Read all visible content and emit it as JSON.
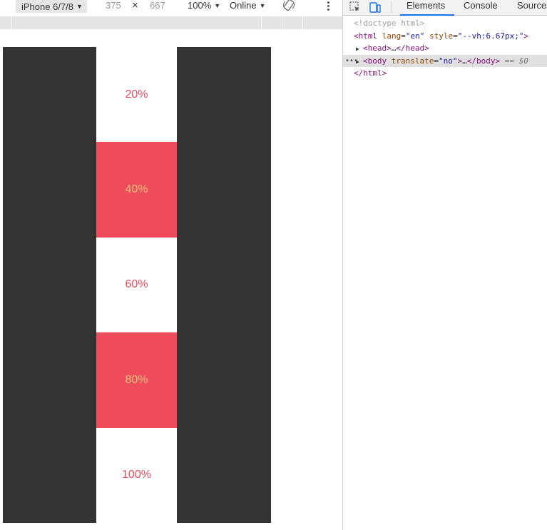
{
  "device_toolbar": {
    "device_name": "iPhone 6/7/8",
    "width": "375",
    "height": "667",
    "times": "×",
    "zoom": "100%",
    "network": "Online"
  },
  "viewport": {
    "cells": [
      {
        "label": "20%",
        "style": "white"
      },
      {
        "label": "40%",
        "style": "red"
      },
      {
        "label": "60%",
        "style": "white"
      },
      {
        "label": "80%",
        "style": "red"
      },
      {
        "label": "100%",
        "style": "white"
      }
    ]
  },
  "devtools": {
    "tabs": [
      {
        "label": "Elements",
        "active": true
      },
      {
        "label": "Console",
        "active": false
      },
      {
        "label": "Sources",
        "active": false
      }
    ],
    "dom": {
      "doctype": "<!doctype html>",
      "html_open_tag": "<html",
      "html_attr1_name": "lang",
      "html_attr1_val": "\"en\"",
      "html_attr2_name": "style",
      "html_attr2_val": "\"--vh:6.67px;\"",
      "html_close_bracket": ">",
      "head_line": "<head>",
      "head_dots": "…",
      "head_close": "</head>",
      "body_open": "<body",
      "body_attr_name": "translate",
      "body_attr_val": "\"no\"",
      "body_gt": ">",
      "body_dots": "…",
      "body_close": "</body>",
      "selected_marker": "== $0",
      "html_close": "</html>"
    }
  },
  "colors": {
    "accent_red": "#ee4b5b",
    "label_red": "#ef4b5a",
    "label_amber": "#f3c37a",
    "viewport_bg": "#333333"
  }
}
